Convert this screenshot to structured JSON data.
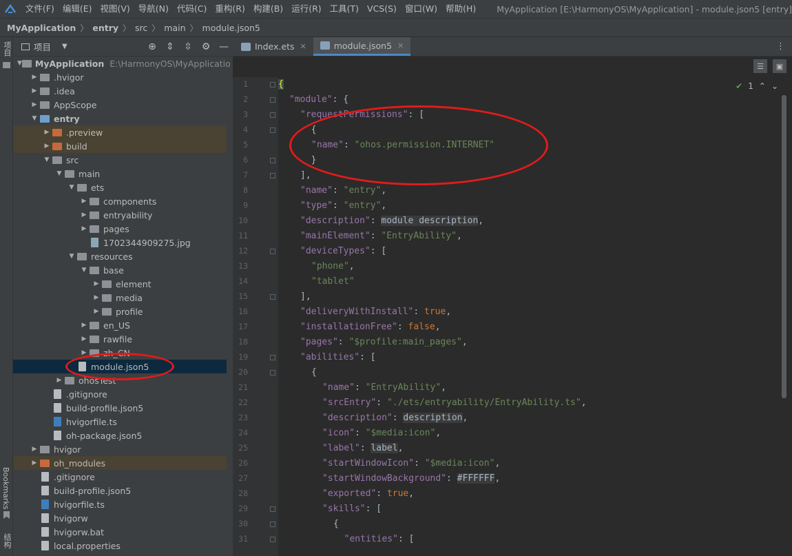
{
  "menubar": {
    "items": [
      "文件(F)",
      "编辑(E)",
      "视图(V)",
      "导航(N)",
      "代码(C)",
      "重构(R)",
      "构建(B)",
      "运行(R)",
      "工具(T)",
      "VCS(S)",
      "窗口(W)",
      "帮助(H)"
    ],
    "window_title": "MyApplication [E:\\HarmonyOS\\MyApplication] - module.json5 [entry]"
  },
  "breadcrumb": {
    "items": [
      "MyApplication",
      "entry",
      "src",
      "main",
      "module.json5"
    ]
  },
  "left_strip": {
    "top_label": "项目",
    "bookmarks_label": "Bookmarks",
    "structure_label": "结构"
  },
  "project_panel": {
    "title": "项目"
  },
  "tree": [
    {
      "label": "MyApplication",
      "path": "E:\\HarmonyOS\\MyApplicatio",
      "depth": 0,
      "open": true,
      "icon": "folder",
      "bold": true
    },
    {
      "label": ".hvigor",
      "depth": 1,
      "open": false,
      "icon": "folder"
    },
    {
      "label": ".idea",
      "depth": 1,
      "open": false,
      "icon": "folder"
    },
    {
      "label": "AppScope",
      "depth": 1,
      "open": false,
      "icon": "folder"
    },
    {
      "label": "entry",
      "depth": 1,
      "open": true,
      "icon": "folder-module",
      "bold": true
    },
    {
      "label": ".preview",
      "depth": 2,
      "open": false,
      "icon": "folder-orange",
      "hl": "orange"
    },
    {
      "label": "build",
      "depth": 2,
      "open": false,
      "icon": "folder-orange",
      "hl": "orange"
    },
    {
      "label": "src",
      "depth": 2,
      "open": true,
      "icon": "folder"
    },
    {
      "label": "main",
      "depth": 3,
      "open": true,
      "icon": "folder"
    },
    {
      "label": "ets",
      "depth": 4,
      "open": true,
      "icon": "folder"
    },
    {
      "label": "components",
      "depth": 5,
      "open": false,
      "icon": "folder"
    },
    {
      "label": "entryability",
      "depth": 5,
      "open": false,
      "icon": "folder"
    },
    {
      "label": "pages",
      "depth": 5,
      "open": false,
      "icon": "folder"
    },
    {
      "label": "1702344909275.jpg",
      "depth": 5,
      "leaf": true,
      "icon": "image"
    },
    {
      "label": "resources",
      "depth": 4,
      "open": true,
      "icon": "folder"
    },
    {
      "label": "base",
      "depth": 5,
      "open": true,
      "icon": "folder"
    },
    {
      "label": "element",
      "depth": 6,
      "open": false,
      "icon": "folder"
    },
    {
      "label": "media",
      "depth": 6,
      "open": false,
      "icon": "folder"
    },
    {
      "label": "profile",
      "depth": 6,
      "open": false,
      "icon": "folder"
    },
    {
      "label": "en_US",
      "depth": 5,
      "open": false,
      "icon": "folder"
    },
    {
      "label": "rawfile",
      "depth": 5,
      "open": false,
      "icon": "folder"
    },
    {
      "label": "zh_CN",
      "depth": 5,
      "open": false,
      "icon": "folder"
    },
    {
      "label": "module.json5",
      "depth": 4,
      "leaf": true,
      "icon": "file",
      "hl": "selected"
    },
    {
      "label": "ohosTest",
      "depth": 3,
      "open": false,
      "icon": "folder"
    },
    {
      "label": ".gitignore",
      "depth": 2,
      "leaf": true,
      "icon": "file"
    },
    {
      "label": "build-profile.json5",
      "depth": 2,
      "leaf": true,
      "icon": "file"
    },
    {
      "label": "hvigorfile.ts",
      "depth": 2,
      "leaf": true,
      "icon": "ts"
    },
    {
      "label": "oh-package.json5",
      "depth": 2,
      "leaf": true,
      "icon": "file"
    },
    {
      "label": "hvigor",
      "depth": 1,
      "open": false,
      "icon": "folder"
    },
    {
      "label": "oh_modules",
      "depth": 1,
      "open": false,
      "icon": "folder-orange",
      "hl": "orange"
    },
    {
      "label": ".gitignore",
      "depth": 1,
      "leaf": true,
      "icon": "file"
    },
    {
      "label": "build-profile.json5",
      "depth": 1,
      "leaf": true,
      "icon": "file"
    },
    {
      "label": "hvigorfile.ts",
      "depth": 1,
      "leaf": true,
      "icon": "ts"
    },
    {
      "label": "hvigorw",
      "depth": 1,
      "leaf": true,
      "icon": "file"
    },
    {
      "label": "hvigorw.bat",
      "depth": 1,
      "leaf": true,
      "icon": "file"
    },
    {
      "label": "local.properties",
      "depth": 1,
      "leaf": true,
      "icon": "file"
    }
  ],
  "tabs": [
    {
      "label": "Index.ets",
      "icon": "ets-icon",
      "active": false
    },
    {
      "label": "module.json5",
      "icon": "json-icon",
      "active": true
    }
  ],
  "inspection": {
    "count": "1"
  },
  "code_lines": [
    {
      "n": "1",
      "indent": 0,
      "t": [
        [
          "brace",
          "{"
        ]
      ]
    },
    {
      "n": "2",
      "indent": 1,
      "t": [
        [
          "k",
          "\"module\""
        ],
        [
          "p",
          ": {"
        ]
      ]
    },
    {
      "n": "3",
      "indent": 2,
      "t": [
        [
          "k",
          "\"requestPermissions\""
        ],
        [
          "p",
          ": ["
        ]
      ]
    },
    {
      "n": "4",
      "indent": 2,
      "t": [
        [
          "p",
          "  {"
        ]
      ]
    },
    {
      "n": "5",
      "indent": 3,
      "t": [
        [
          "k",
          "\"name\""
        ],
        [
          "p",
          ": "
        ],
        [
          "s",
          "\"ohos.permission.INTERNET\""
        ]
      ]
    },
    {
      "n": "6",
      "indent": 2,
      "t": [
        [
          "p",
          "  }"
        ]
      ]
    },
    {
      "n": "7",
      "indent": 2,
      "t": [
        [
          "p",
          "],"
        ]
      ]
    },
    {
      "n": "8",
      "indent": 2,
      "t": [
        [
          "k",
          "\"name\""
        ],
        [
          "p",
          ": "
        ],
        [
          "s",
          "\"entry\""
        ],
        [
          "p",
          ","
        ]
      ]
    },
    {
      "n": "9",
      "indent": 2,
      "t": [
        [
          "k",
          "\"type\""
        ],
        [
          "p",
          ": "
        ],
        [
          "s",
          "\"entry\""
        ],
        [
          "p",
          ","
        ]
      ]
    },
    {
      "n": "10",
      "indent": 2,
      "t": [
        [
          "k",
          "\"description\""
        ],
        [
          "p",
          ": "
        ],
        [
          "v",
          "module description"
        ],
        [
          "p",
          ","
        ]
      ]
    },
    {
      "n": "11",
      "indent": 2,
      "t": [
        [
          "k",
          "\"mainElement\""
        ],
        [
          "p",
          ": "
        ],
        [
          "s",
          "\"EntryAbility\""
        ],
        [
          "p",
          ","
        ]
      ]
    },
    {
      "n": "12",
      "indent": 2,
      "t": [
        [
          "k",
          "\"deviceTypes\""
        ],
        [
          "p",
          ": ["
        ]
      ]
    },
    {
      "n": "13",
      "indent": 3,
      "t": [
        [
          "s",
          "\"phone\""
        ],
        [
          "p",
          ","
        ]
      ]
    },
    {
      "n": "14",
      "indent": 3,
      "t": [
        [
          "s",
          "\"tablet\""
        ]
      ]
    },
    {
      "n": "15",
      "indent": 2,
      "t": [
        [
          "p",
          "],"
        ]
      ]
    },
    {
      "n": "16",
      "indent": 2,
      "t": [
        [
          "k",
          "\"deliveryWithInstall\""
        ],
        [
          "p",
          ": "
        ],
        [
          "kw",
          "true"
        ],
        [
          "p",
          ","
        ]
      ]
    },
    {
      "n": "17",
      "indent": 2,
      "t": [
        [
          "k",
          "\"installationFree\""
        ],
        [
          "p",
          ": "
        ],
        [
          "kw",
          "false"
        ],
        [
          "p",
          ","
        ]
      ]
    },
    {
      "n": "18",
      "indent": 2,
      "t": [
        [
          "k",
          "\"pages\""
        ],
        [
          "p",
          ": "
        ],
        [
          "s",
          "\"$profile:main_pages\""
        ],
        [
          "p",
          ","
        ]
      ]
    },
    {
      "n": "19",
      "indent": 2,
      "t": [
        [
          "k",
          "\"abilities\""
        ],
        [
          "p",
          ": ["
        ]
      ]
    },
    {
      "n": "20",
      "indent": 3,
      "t": [
        [
          "p",
          "{"
        ]
      ]
    },
    {
      "n": "21",
      "indent": 4,
      "t": [
        [
          "k",
          "\"name\""
        ],
        [
          "p",
          ": "
        ],
        [
          "s",
          "\"EntryAbility\""
        ],
        [
          "p",
          ","
        ]
      ]
    },
    {
      "n": "22",
      "indent": 4,
      "t": [
        [
          "k",
          "\"srcEntry\""
        ],
        [
          "p",
          ": "
        ],
        [
          "s",
          "\"./ets/entryability/EntryAbility.ts\""
        ],
        [
          "p",
          ","
        ]
      ]
    },
    {
      "n": "23",
      "indent": 4,
      "t": [
        [
          "k",
          "\"description\""
        ],
        [
          "p",
          ": "
        ],
        [
          "v",
          "description"
        ],
        [
          "p",
          ","
        ]
      ]
    },
    {
      "n": "24",
      "indent": 4,
      "t": [
        [
          "k",
          "\"icon\""
        ],
        [
          "p",
          ": "
        ],
        [
          "s",
          "\"$media:icon\""
        ],
        [
          "p",
          ","
        ]
      ]
    },
    {
      "n": "25",
      "indent": 4,
      "t": [
        [
          "k",
          "\"label\""
        ],
        [
          "p",
          ": "
        ],
        [
          "v",
          "label"
        ],
        [
          "p",
          ","
        ]
      ]
    },
    {
      "n": "26",
      "indent": 4,
      "t": [
        [
          "k",
          "\"startWindowIcon\""
        ],
        [
          "p",
          ": "
        ],
        [
          "s",
          "\"$media:icon\""
        ],
        [
          "p",
          ","
        ]
      ]
    },
    {
      "n": "27",
      "indent": 4,
      "t": [
        [
          "k",
          "\"startWindowBackground\""
        ],
        [
          "p",
          ": "
        ],
        [
          "v",
          "#FFFFFF"
        ],
        [
          "p",
          ","
        ]
      ]
    },
    {
      "n": "28",
      "indent": 4,
      "t": [
        [
          "k",
          "\"exported\""
        ],
        [
          "p",
          ": "
        ],
        [
          "kw",
          "true"
        ],
        [
          "p",
          ","
        ]
      ]
    },
    {
      "n": "29",
      "indent": 4,
      "t": [
        [
          "k",
          "\"skills\""
        ],
        [
          "p",
          ": ["
        ]
      ]
    },
    {
      "n": "30",
      "indent": 5,
      "t": [
        [
          "p",
          "{"
        ]
      ]
    },
    {
      "n": "31",
      "indent": 5,
      "t": [
        [
          "p",
          "  "
        ],
        [
          "k",
          "\"entities\""
        ],
        [
          "p",
          ": ["
        ]
      ]
    }
  ],
  "annotation_color": "#e21b1b"
}
